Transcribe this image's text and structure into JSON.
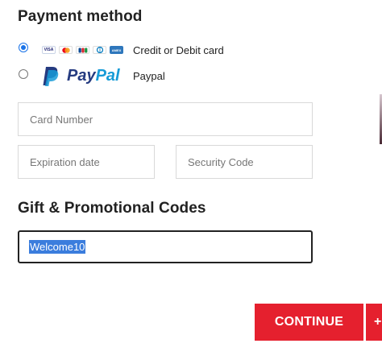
{
  "payment": {
    "title": "Payment method",
    "options": [
      {
        "label": "Credit or Debit card",
        "selected": true,
        "icons": [
          "visa-icon",
          "mastercard-icon",
          "jcb-icon",
          "diners-icon",
          "amex-icon"
        ]
      },
      {
        "label": "Paypal",
        "selected": false,
        "logo_text_pay": "Pay",
        "logo_text_pal": "Pal"
      }
    ],
    "card_number_placeholder": "Card Number",
    "expiration_placeholder": "Expiration date",
    "security_placeholder": "Security Code"
  },
  "promo": {
    "title": "Gift & Promotional Codes",
    "value": "Welcome10"
  },
  "actions": {
    "continue_label": "CONTINUE",
    "secondary_label": "+"
  },
  "colors": {
    "accent_red": "#e5202e",
    "paypal_dark": "#253b80",
    "paypal_light": "#179bd7",
    "selection": "#3b7ddd"
  }
}
